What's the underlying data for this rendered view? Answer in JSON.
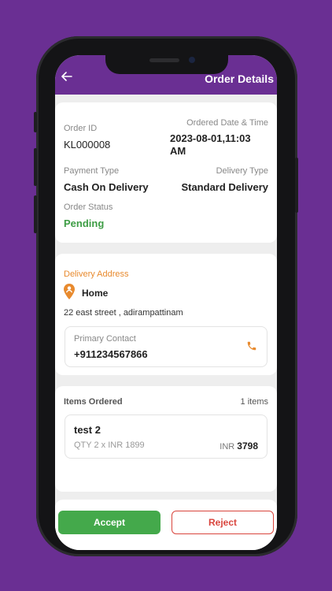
{
  "header": {
    "title": "Order Details"
  },
  "order": {
    "order_id_label": "Order ID",
    "order_id": "KL000008",
    "date_label": "Ordered Date & Time",
    "date_line1": "2023-08-01,11:03",
    "date_line2": "AM",
    "payment_label": "Payment Type",
    "payment": "Cash On Delivery",
    "delivery_label": "Delivery Type",
    "delivery": "Standard Delivery",
    "status_label": "Order Status",
    "status": "Pending"
  },
  "address": {
    "section_label": "Delivery Address",
    "name": "Home",
    "line": "22 east street , adirampattinam",
    "contact_label": "Primary Contact",
    "contact_value": "+911234567866"
  },
  "items": {
    "section_label": "Items Ordered",
    "count": "1 items",
    "list": [
      {
        "name": "test 2",
        "qty_price": "QTY 2 x INR 1899",
        "total_prefix": "INR",
        "total": "3798"
      }
    ]
  },
  "actions": {
    "accept": "Accept",
    "reject": "Reject"
  },
  "colors": {
    "brand": "#6a2f93",
    "accent_orange": "#e88a2e",
    "status_green": "#3e9d45",
    "reject_red": "#d9453d"
  }
}
